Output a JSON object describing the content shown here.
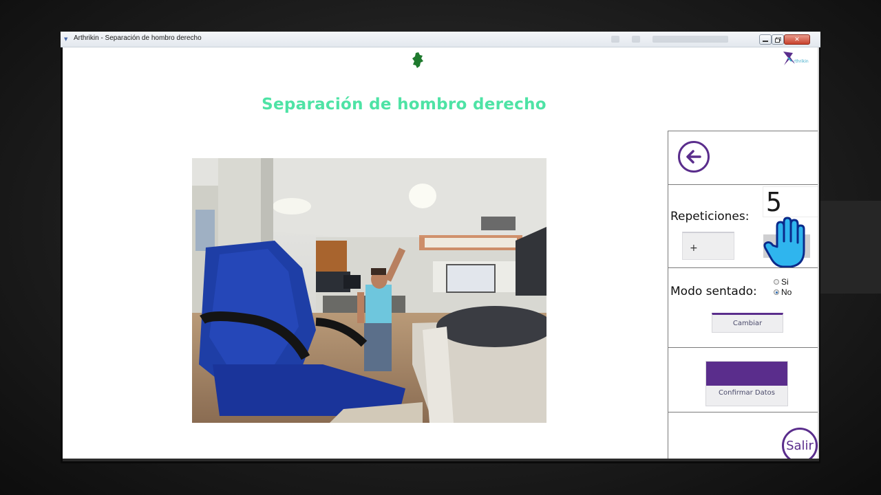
{
  "window": {
    "title": "Arthrikin - Separación de hombro derecho",
    "minimize_icon": "minimize-icon",
    "maximize_icon": "maximize-icon",
    "close_glyph": "✕"
  },
  "header": {
    "title": "Separación de hombro derecho",
    "title_color": "#4ee3a5",
    "corner_logo_text": "rthrikin"
  },
  "panel": {
    "accent_color": "#5a2d8c",
    "repetitions": {
      "label": "Repeticiones:",
      "value": "5",
      "plus_label": "+"
    },
    "seated_mode": {
      "label": "Modo sentado:",
      "options": [
        {
          "label": "Si",
          "selected": false
        },
        {
          "label": "No",
          "selected": true
        }
      ],
      "change_button": "Cambiar"
    },
    "confirm_button": "Confirmar Datos",
    "exit_button": "Salir"
  }
}
